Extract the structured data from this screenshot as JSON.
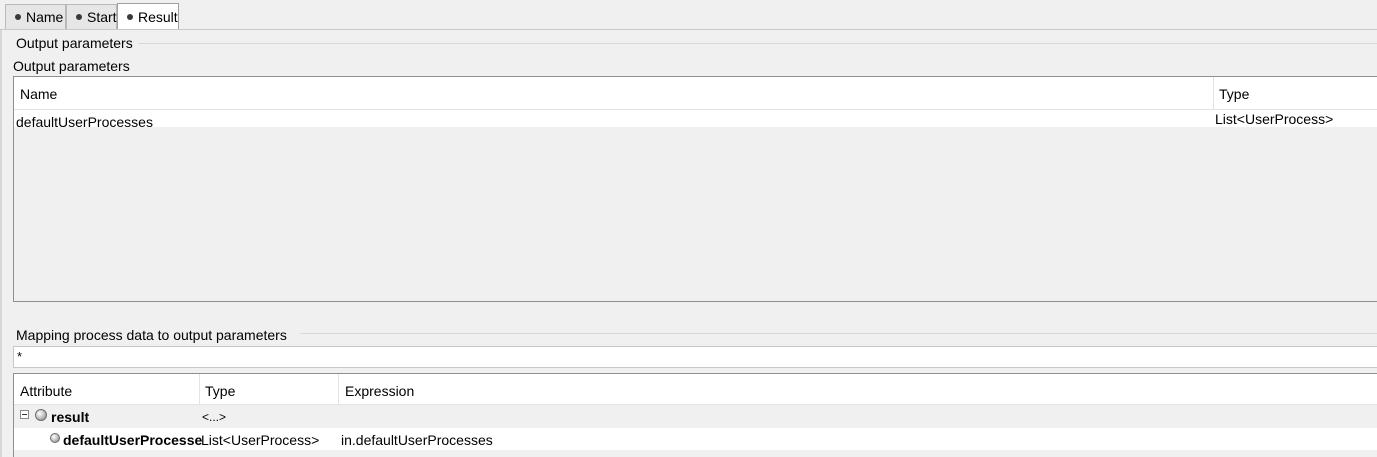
{
  "tabs": [
    {
      "label": "Name",
      "active": false
    },
    {
      "label": "Start",
      "active": false
    },
    {
      "label": "Result",
      "active": true
    }
  ],
  "output_section": {
    "group_title": "Output parameters",
    "table_title": "Output parameters",
    "columns": [
      "Name",
      "Type"
    ],
    "rows": [
      {
        "name": "defaultUserProcesses",
        "type": "List<UserProcess>"
      }
    ]
  },
  "mapping_section": {
    "group_title": "Mapping process data to output parameters",
    "filter_value": "*",
    "columns": [
      "Attribute",
      "Type",
      "Expression"
    ],
    "rows": [
      {
        "attribute": "result",
        "type": "<...>",
        "expression": "",
        "expanded": true,
        "level": 0
      },
      {
        "attribute": "defaultUserProcesse",
        "type": "List<UserProcess>",
        "expression": "in.defaultUserProcesses",
        "level": 1
      }
    ]
  }
}
